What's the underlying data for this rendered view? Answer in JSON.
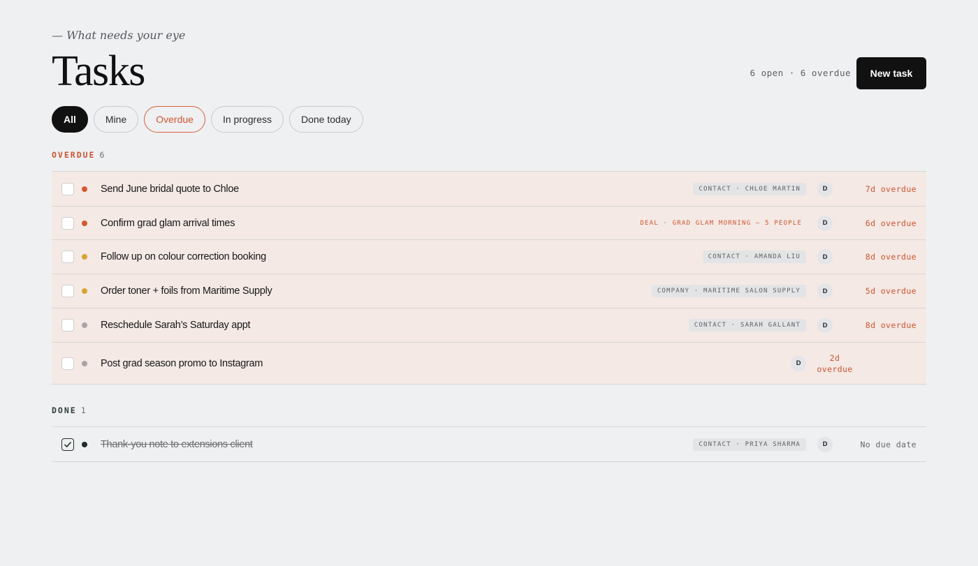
{
  "header": {
    "eyebrow": "— What needs your eye",
    "title": "Tasks",
    "summary": "6 open · 6 overdue",
    "new_task_label": "New task"
  },
  "filters": [
    {
      "label": "All",
      "state": "active"
    },
    {
      "label": "Mine",
      "state": "default"
    },
    {
      "label": "Overdue",
      "state": "overdue"
    },
    {
      "label": "In progress",
      "state": "default"
    },
    {
      "label": "Done today",
      "state": "default"
    }
  ],
  "sections": {
    "overdue": {
      "label": "OVERDUE",
      "count": "6",
      "tasks": [
        {
          "title": "Send June bridal quote to Chloe",
          "priority_color": "#d4582f",
          "tag": "CONTACT · CHLOE MARTIN",
          "tag_type": "contact",
          "assignee": "D",
          "due": "7d overdue",
          "completed": false
        },
        {
          "title": "Confirm grad glam arrival times",
          "priority_color": "#d4582f",
          "tag": "DEAL · GRAD GLAM MORNING — 5 PEOPLE",
          "tag_type": "deal",
          "assignee": "D",
          "due": "6d overdue",
          "completed": false
        },
        {
          "title": "Follow up on colour correction booking",
          "priority_color": "#d5a434",
          "tag": "CONTACT · AMANDA LIU",
          "tag_type": "contact",
          "assignee": "D",
          "due": "8d overdue",
          "completed": false
        },
        {
          "title": "Order toner + foils from Maritime Supply",
          "priority_color": "#d5a434",
          "tag": "COMPANY · MARITIME SALON SUPPLY",
          "tag_type": "contact",
          "assignee": "D",
          "due": "5d overdue",
          "completed": false
        },
        {
          "title": "Reschedule Sarah’s Saturday appt",
          "priority_color": "#a8a6a6",
          "tag": "CONTACT · SARAH GALLANT",
          "tag_type": "contact",
          "assignee": "D",
          "due": "8d overdue",
          "completed": false
        },
        {
          "title": "Post grad season promo to Instagram",
          "priority_color": "#a8a6a6",
          "tag": "",
          "tag_type": "none",
          "assignee": "D",
          "due": "2d overdue",
          "completed": false
        }
      ]
    },
    "done": {
      "label": "DONE",
      "count": "1",
      "tasks": [
        {
          "title": "Thank-you note to extensions client",
          "priority_color": "#1f2c2a",
          "tag": "CONTACT · PRIYA SHARMA",
          "tag_type": "contact",
          "assignee": "D",
          "due": "No due date",
          "completed": true
        }
      ]
    }
  },
  "icons": {
    "checkbox_checked": "check-icon"
  }
}
